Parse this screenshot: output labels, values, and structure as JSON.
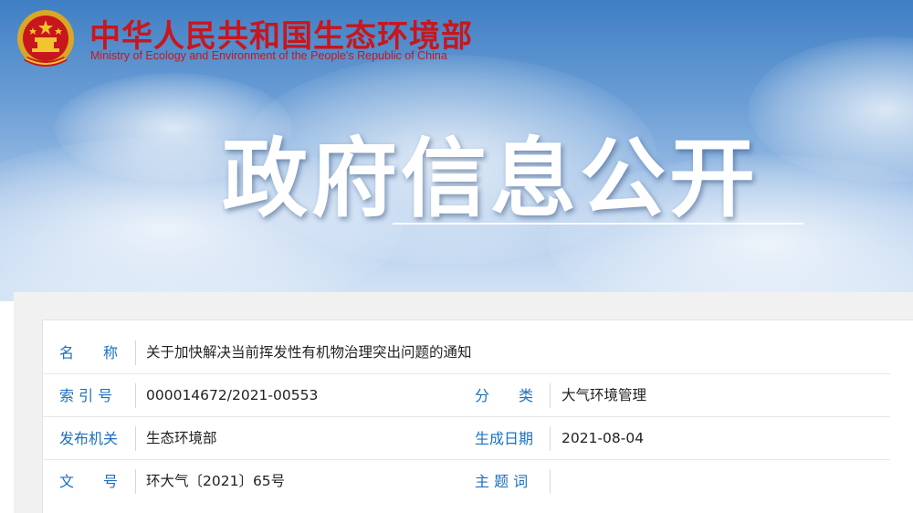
{
  "header": {
    "org_name_cn": "中华人民共和国生态环境部",
    "org_name_en": "Ministry of Ecology and Environment of the People's Republic of China",
    "emblem_icon": "national-emblem-icon",
    "brand_red": "#c8161d"
  },
  "banner": {
    "title": "政府信息公开"
  },
  "info": {
    "name_label": "名　　称",
    "name_value": "关于加快解决当前挥发性有机物治理突出问题的通知",
    "index_label": "索 引 号",
    "index_value": "000014672/2021-00553",
    "category_label": "分　　类",
    "category_value": "大气环境管理",
    "issuer_label": "发布机关",
    "issuer_value": "生态环境部",
    "date_label": "生成日期",
    "date_value": "2021-08-04",
    "docno_label": "文　　号",
    "docno_value": "环大气〔2021〕65号",
    "keywords_label": "主 题 词",
    "keywords_value": "",
    "label_color": "#1b70c2"
  }
}
